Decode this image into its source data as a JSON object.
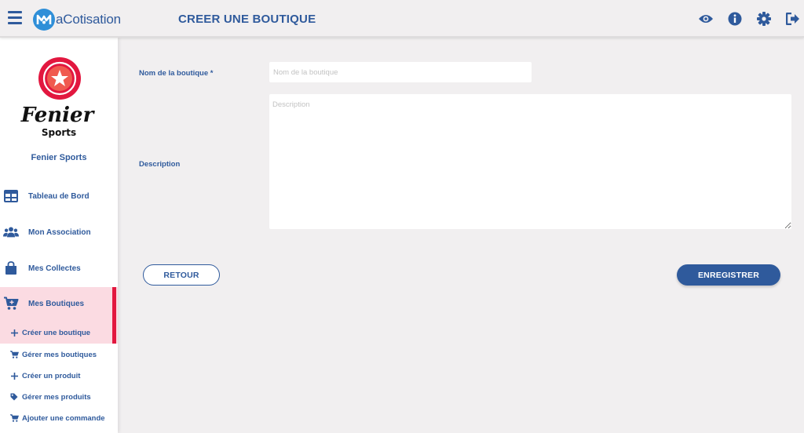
{
  "header": {
    "logo_text": "aCotisation",
    "title": "CREER UNE BOUTIQUE",
    "icons": [
      "eye-icon",
      "info-icon",
      "gear-icon",
      "logout-icon"
    ]
  },
  "sidebar": {
    "brand_logo_line1": "Fenier",
    "brand_logo_line2": "Sports",
    "brand_name": "Fenier Sports",
    "items": [
      {
        "label": "Tableau de Bord",
        "icon": "dashboard-icon"
      },
      {
        "label": "Mon Association",
        "icon": "users-icon"
      },
      {
        "label": "Mes Collectes",
        "icon": "bag-icon"
      },
      {
        "label": "Mes Boutiques",
        "icon": "cart-plus-icon"
      }
    ],
    "sub_items": [
      {
        "label": "Créer une boutique",
        "icon": "plus-icon"
      },
      {
        "label": "Gérer mes boutiques",
        "icon": "cart-icon"
      },
      {
        "label": "Créer un produit",
        "icon": "plus-icon"
      },
      {
        "label": "Gérer mes produits",
        "icon": "tag-icon"
      },
      {
        "label": "Ajouter une commande",
        "icon": "cart-icon"
      }
    ]
  },
  "form": {
    "name_label": "Nom de la boutique *",
    "name_placeholder": "Nom de la boutique",
    "name_value": "",
    "description_label": "Description",
    "description_placeholder": "Description",
    "description_value": ""
  },
  "actions": {
    "back_label": "RETOUR",
    "save_label": "ENREGISTRER"
  },
  "colors": {
    "primary": "#2f5a9c",
    "accent": "#e2173f",
    "active_bg": "#fbdbe2",
    "background": "#f1eff0"
  }
}
